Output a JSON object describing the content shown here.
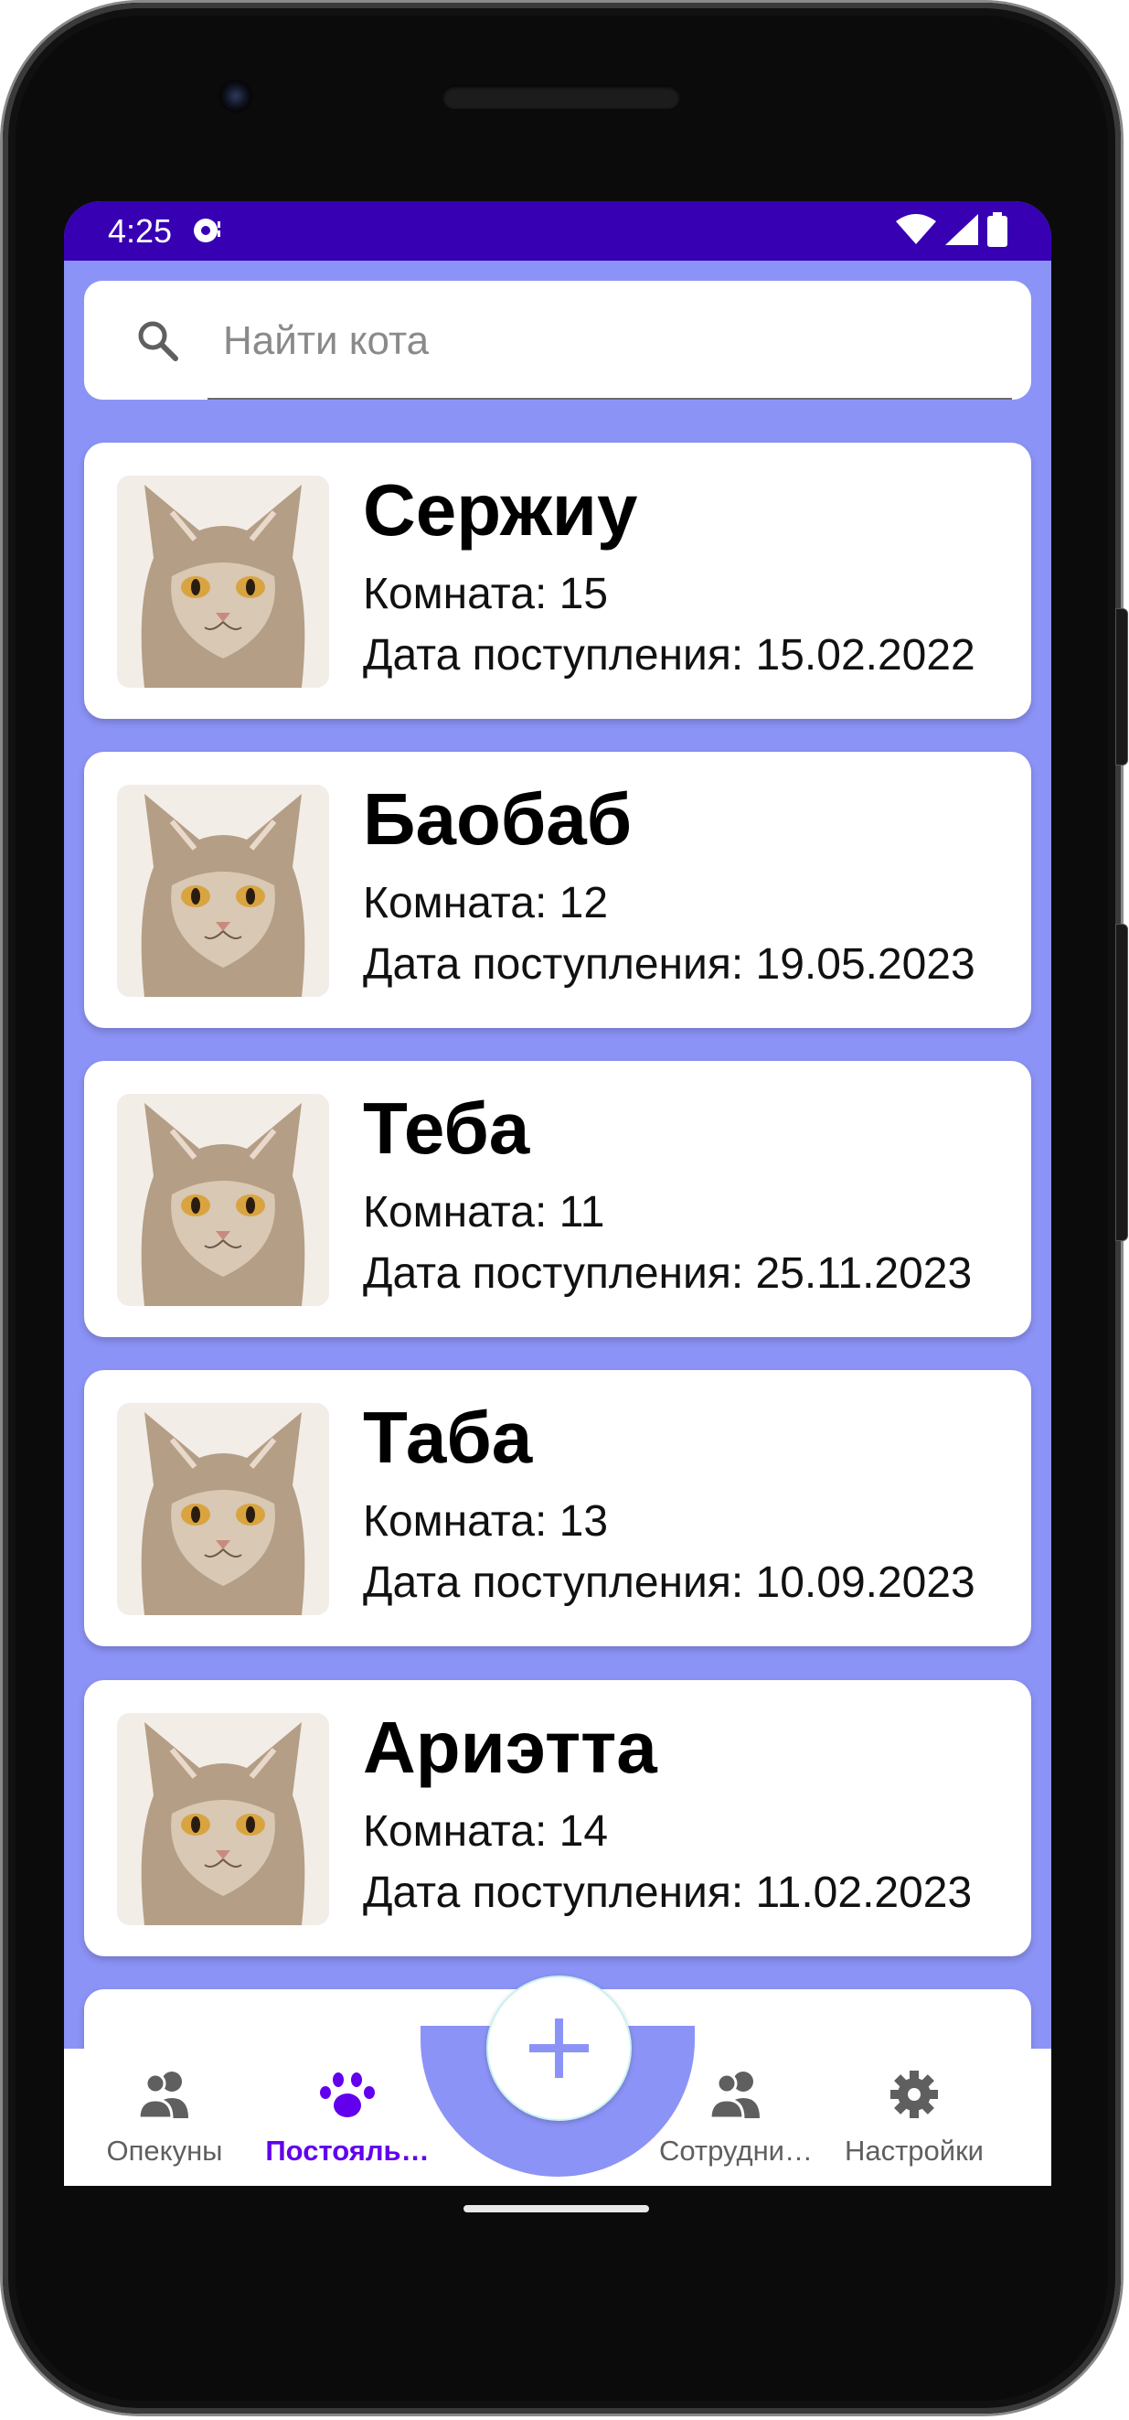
{
  "status_bar": {
    "time": "4:25"
  },
  "search": {
    "placeholder": "Найти кота"
  },
  "cats": [
    {
      "name": "Сержиу",
      "room": "Комната: 15",
      "date": "Дата поступления: 15.02.2022"
    },
    {
      "name": "Баобаб",
      "room": "Комната: 12",
      "date": "Дата поступления: 19.05.2023"
    },
    {
      "name": "Теба",
      "room": "Комната: 11",
      "date": "Дата поступления: 25.11.2023"
    },
    {
      "name": "Таба",
      "room": "Комната: 13",
      "date": "Дата поступления: 10.09.2023"
    },
    {
      "name": "Ариэтта",
      "room": "Комната: 14",
      "date": "Дата поступления: 11.02.2023"
    }
  ],
  "fab": {
    "icon": "plus-icon"
  },
  "bottom_nav": {
    "items": [
      {
        "label": "Опекуны",
        "icon": "people-icon",
        "active": false
      },
      {
        "label": "Постояль…",
        "icon": "paw-icon",
        "active": true
      },
      {
        "label": "Сотрудни…",
        "icon": "people-icon",
        "active": false
      },
      {
        "label": "Настройки",
        "icon": "gear-icon",
        "active": false
      }
    ]
  },
  "colors": {
    "status_bar": "#3700b3",
    "background": "#8c93f6",
    "active_nav": "#6200ee",
    "fab_plus": "#8c93f6"
  }
}
